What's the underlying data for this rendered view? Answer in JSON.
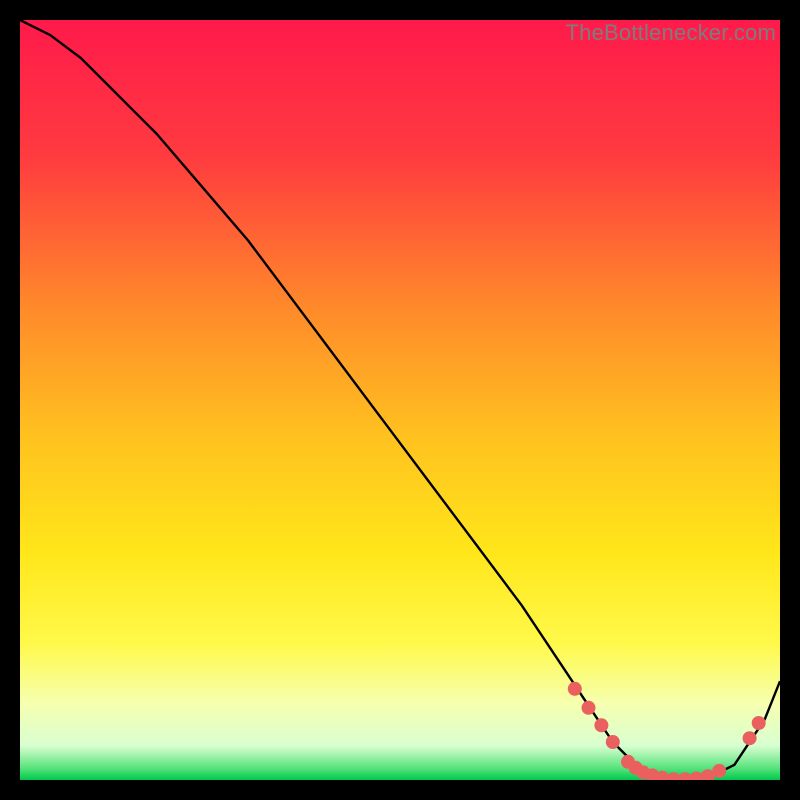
{
  "watermark": "TheBottleneсker.com",
  "chart_data": {
    "type": "line",
    "title": "",
    "xlabel": "",
    "ylabel": "",
    "xlim": [
      0,
      100
    ],
    "ylim": [
      0,
      100
    ],
    "gradient_stops": [
      {
        "offset": 0,
        "color": "#ff1a4b"
      },
      {
        "offset": 0.18,
        "color": "#ff3b3f"
      },
      {
        "offset": 0.38,
        "color": "#ff8a2a"
      },
      {
        "offset": 0.55,
        "color": "#ffc21f"
      },
      {
        "offset": 0.7,
        "color": "#ffe61a"
      },
      {
        "offset": 0.82,
        "color": "#fff94a"
      },
      {
        "offset": 0.9,
        "color": "#f6ffb0"
      },
      {
        "offset": 0.955,
        "color": "#d8ffd0"
      },
      {
        "offset": 0.985,
        "color": "#55e27a"
      },
      {
        "offset": 1.0,
        "color": "#00c84e"
      }
    ],
    "series": [
      {
        "name": "curve",
        "x": [
          0,
          4,
          8,
          12,
          18,
          24,
          30,
          36,
          42,
          48,
          54,
          60,
          66,
          70,
          74,
          78,
          82,
          86,
          90,
          94,
          98,
          100
        ],
        "y": [
          100,
          98,
          95,
          91,
          85,
          78,
          71,
          63,
          55,
          47,
          39,
          31,
          23,
          17,
          11,
          5,
          1,
          0,
          0,
          2,
          8,
          13
        ]
      }
    ],
    "markers": {
      "color": "#e9605f",
      "radius_px": 7,
      "points": [
        {
          "x": 73.0,
          "y": 12.0
        },
        {
          "x": 74.8,
          "y": 9.5
        },
        {
          "x": 76.5,
          "y": 7.2
        },
        {
          "x": 78.0,
          "y": 5.0
        },
        {
          "x": 80.0,
          "y": 2.4
        },
        {
          "x": 81.0,
          "y": 1.6
        },
        {
          "x": 82.0,
          "y": 1.0
        },
        {
          "x": 83.2,
          "y": 0.6
        },
        {
          "x": 84.5,
          "y": 0.3
        },
        {
          "x": 86.0,
          "y": 0.1
        },
        {
          "x": 87.5,
          "y": 0.1
        },
        {
          "x": 89.0,
          "y": 0.2
        },
        {
          "x": 90.5,
          "y": 0.5
        },
        {
          "x": 92.0,
          "y": 1.2
        },
        {
          "x": 96.0,
          "y": 5.5
        },
        {
          "x": 97.2,
          "y": 7.5
        }
      ]
    }
  }
}
